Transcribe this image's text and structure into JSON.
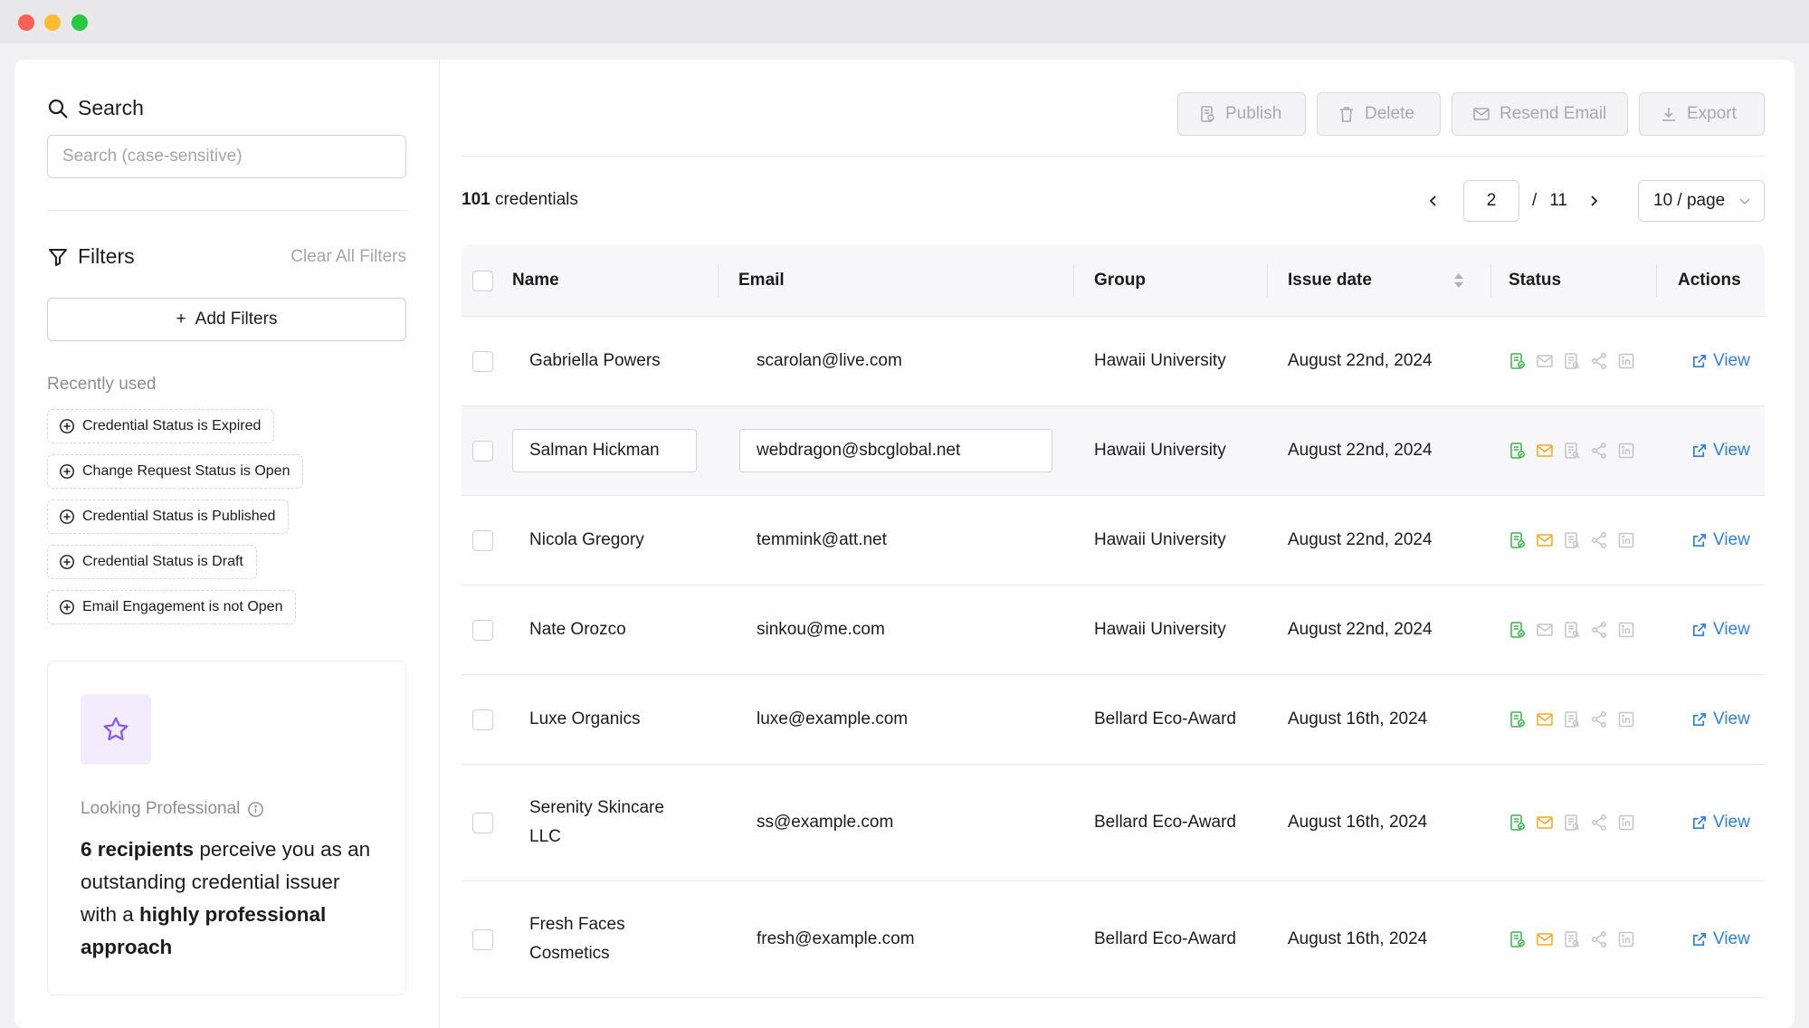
{
  "window": {
    "controls": [
      "close",
      "minimize",
      "maximize"
    ]
  },
  "sidebar": {
    "search_title": "Search",
    "search_placeholder": "Search (case-sensitive)",
    "filters_title": "Filters",
    "clear_all": "Clear All Filters",
    "add_filters": "Add Filters",
    "recent_label": "Recently used",
    "recent": [
      "Credential Status is Expired",
      "Change Request Status is Open",
      "Credential Status is Published",
      "Credential Status is Draft",
      "Email Engagement is not Open"
    ],
    "promo": {
      "label": "Looking Professional",
      "bold1": "6 recipients",
      "text1": " perceive you as an outstanding credential issuer with a ",
      "bold2": "highly professional approach"
    }
  },
  "toolbar": {
    "publish": "Publish",
    "delete": "Delete",
    "resend": "Resend Email",
    "export": "Export"
  },
  "summary": {
    "count": "101",
    "count_label": " credentials"
  },
  "pagination": {
    "current": "2",
    "separator": "/",
    "total": "11",
    "page_size": "10 / page"
  },
  "table": {
    "headers": {
      "name": "Name",
      "email": "Email",
      "group": "Group",
      "issue_date": "Issue date",
      "status": "Status",
      "actions": "Actions"
    },
    "rows": [
      {
        "name": "Gabriella Powers",
        "email": "scarolan@live.com",
        "group": "Hawaii University",
        "date": "August 22nd, 2024",
        "action": "View",
        "email_status": "unsent"
      },
      {
        "name": "Salman Hickman",
        "email": "webdragon@sbcglobal.net",
        "group": "Hawaii University",
        "date": "August 22nd, 2024",
        "action": "View",
        "email_status": "sent"
      },
      {
        "name": "Nicola Gregory",
        "email": "temmink@att.net",
        "group": "Hawaii University",
        "date": "August 22nd, 2024",
        "action": "View",
        "email_status": "sent"
      },
      {
        "name": "Nate Orozco",
        "email": "sinkou@me.com",
        "group": "Hawaii University",
        "date": "August 22nd, 2024",
        "action": "View",
        "email_status": "unsent"
      },
      {
        "name": "Luxe Organics",
        "email": "luxe@example.com",
        "group": "Bellard Eco-Award",
        "date": "August 16th, 2024",
        "action": "View",
        "email_status": "sent"
      },
      {
        "name": "Serenity Skincare LLC",
        "email": "ss@example.com",
        "group": "Bellard Eco-Award",
        "date": "August 16th, 2024",
        "action": "View",
        "email_status": "sent"
      },
      {
        "name": "Fresh Faces Cosmetics",
        "email": "fresh@example.com",
        "group": "Bellard Eco-Award",
        "date": "August 16th, 2024",
        "action": "View",
        "email_status": "sent"
      }
    ]
  },
  "colors": {
    "published": "#3db24b",
    "email_sent": "#f5a524",
    "inactive": "#c4c4ca",
    "link": "#2f7fe0",
    "promo_accent": "#8b5cf6"
  }
}
